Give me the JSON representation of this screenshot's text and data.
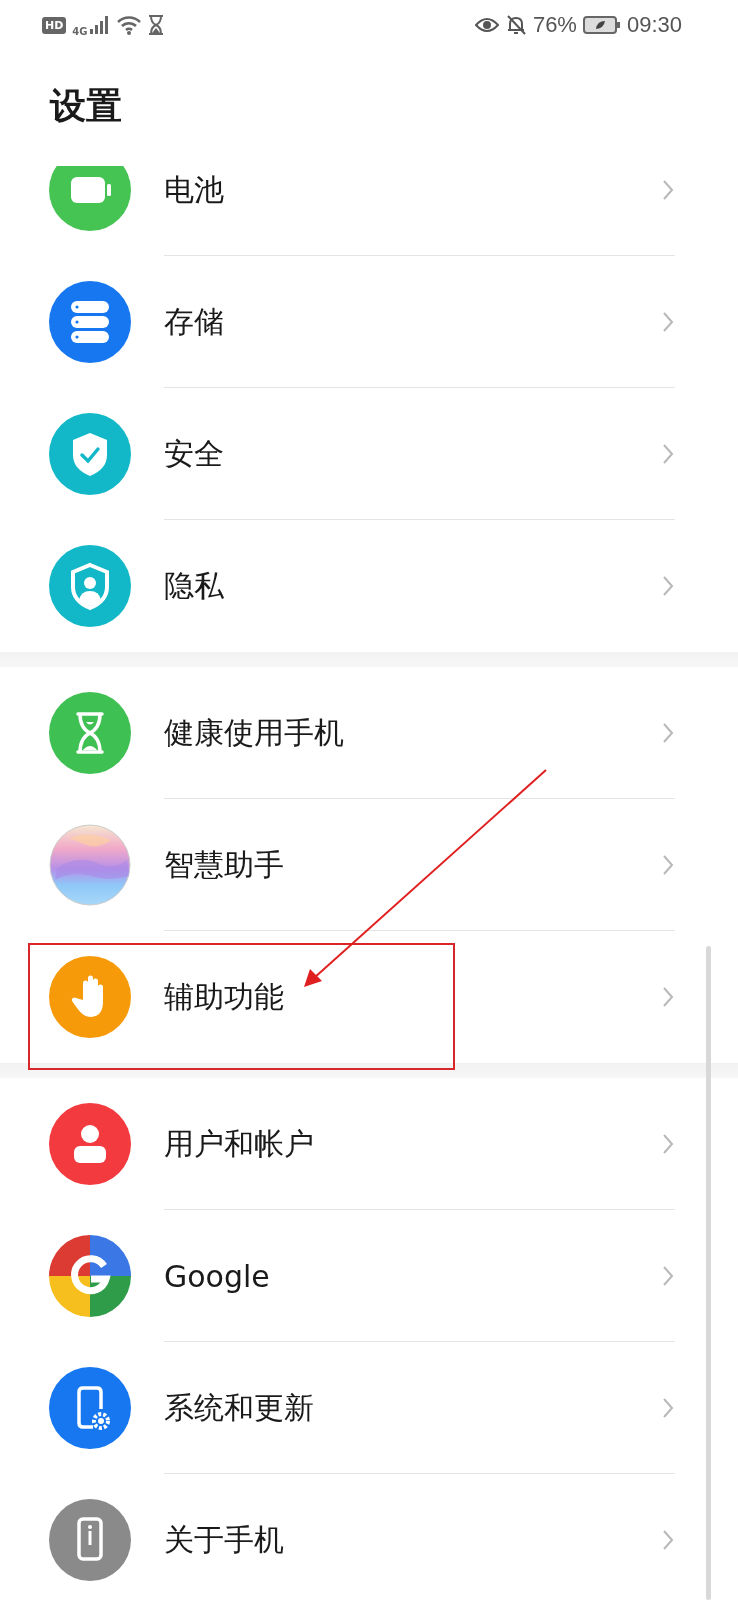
{
  "status_bar": {
    "hd_badge": "HD",
    "network": "4G",
    "battery_percent": "76%",
    "time": "09:30"
  },
  "title": "设置",
  "groups": [
    {
      "items": [
        {
          "label": "电池",
          "kind": "battery",
          "highlighted": false
        },
        {
          "label": "存储",
          "kind": "storage",
          "highlighted": false
        },
        {
          "label": "安全",
          "kind": "security",
          "highlighted": false
        },
        {
          "label": "隐私",
          "kind": "privacy",
          "highlighted": false
        }
      ]
    },
    {
      "items": [
        {
          "label": "健康使用手机",
          "kind": "wellbeing",
          "highlighted": false
        },
        {
          "label": "智慧助手",
          "kind": "assistant",
          "highlighted": false
        },
        {
          "label": "辅助功能",
          "kind": "accessibility",
          "highlighted": true
        }
      ]
    },
    {
      "items": [
        {
          "label": "用户和帐户",
          "kind": "users",
          "highlighted": false
        },
        {
          "label": "Google",
          "kind": "google",
          "highlighted": false
        },
        {
          "label": "系统和更新",
          "kind": "system",
          "highlighted": false
        },
        {
          "label": "关于手机",
          "kind": "about",
          "highlighted": false
        }
      ]
    }
  ]
}
